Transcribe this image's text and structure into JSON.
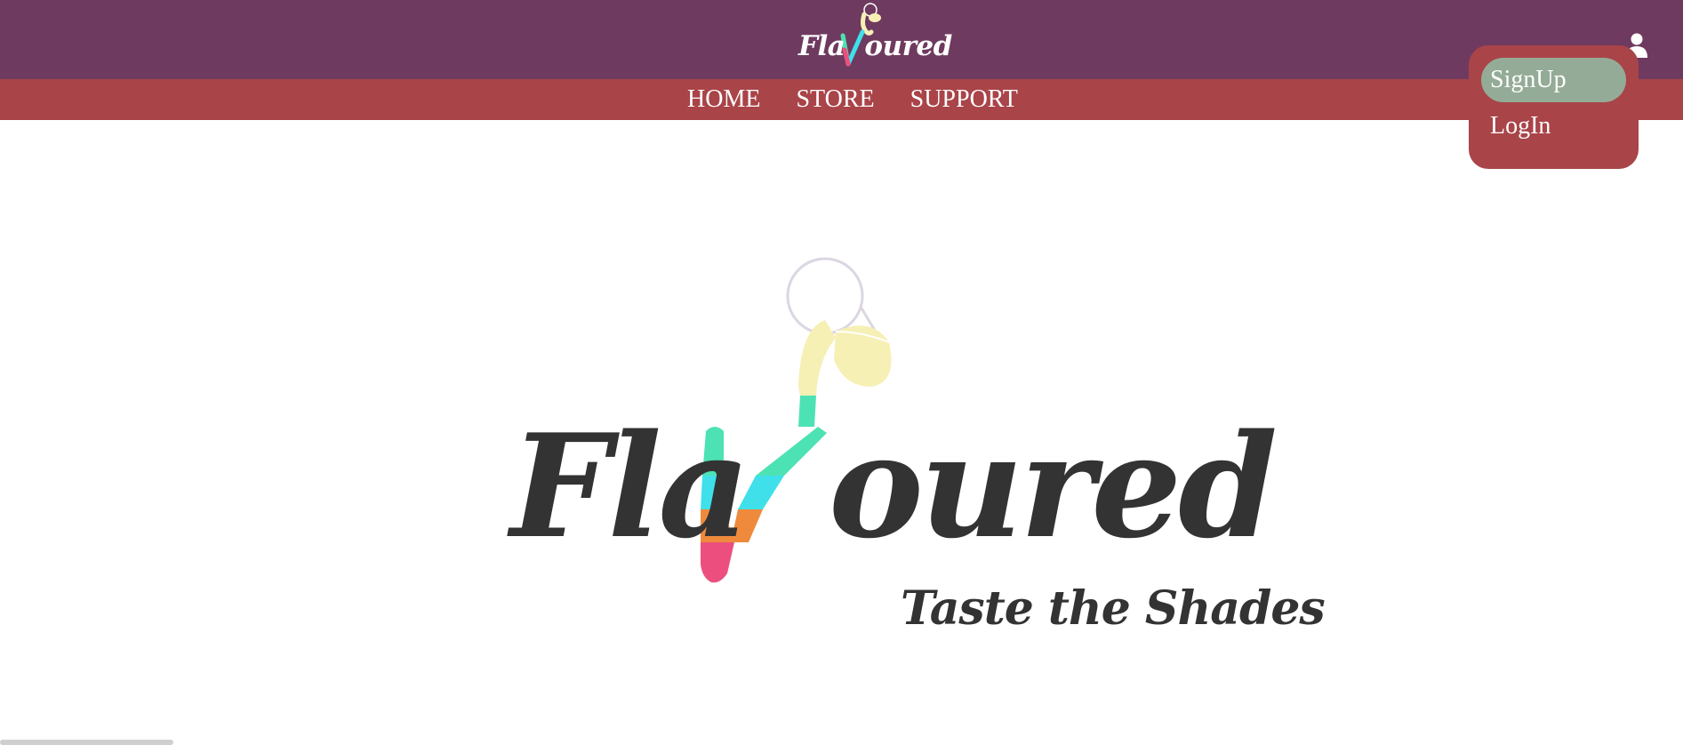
{
  "header": {
    "brand": "FlaVoured",
    "brand_prefix": "Fla",
    "brand_suffix": "oured"
  },
  "nav": {
    "items": [
      "HOME",
      "STORE",
      "SUPPORT"
    ]
  },
  "account_menu": {
    "signup_label": "SignUp",
    "login_label": "LogIn"
  },
  "hero": {
    "brand_prefix": "Fla",
    "brand_suffix": "oured",
    "tagline": "Taste the Shades"
  },
  "icons": {
    "user": "user-icon",
    "pitcher": "pitcher-icon"
  },
  "colors": {
    "header_bg": "#6f3a5f",
    "nav_bg": "#a94449",
    "dropdown_active": "#94ac97",
    "v_green": "#4de2b3",
    "v_cyan": "#3fe0ea",
    "v_orange": "#ef8a3c",
    "v_pink": "#ec4f7e",
    "juice": "#f7f0b5"
  }
}
